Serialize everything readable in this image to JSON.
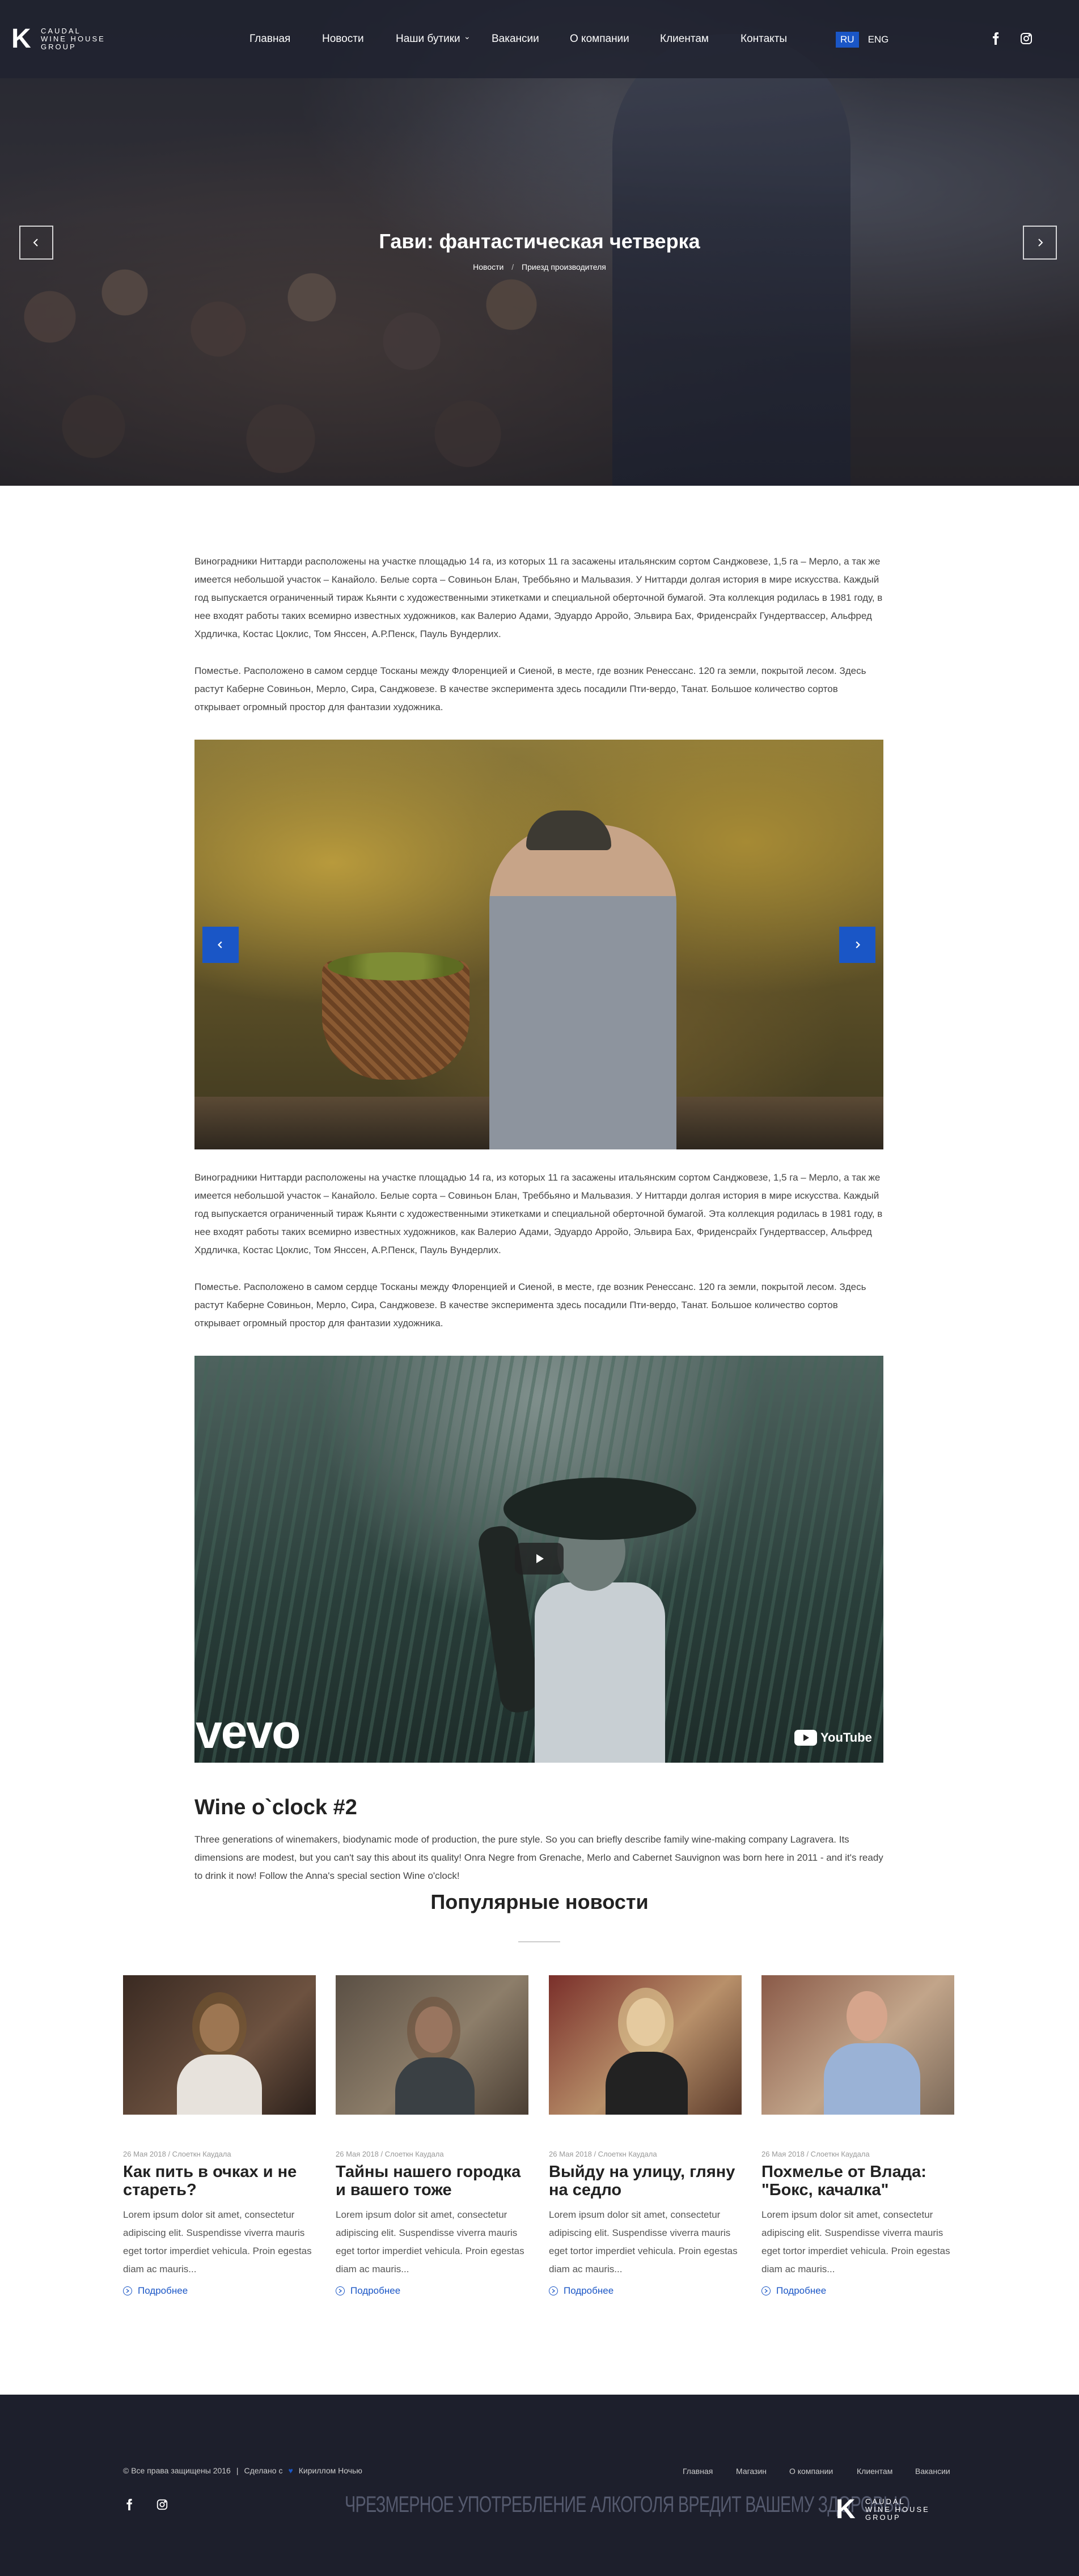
{
  "header": {
    "logo_letter": "K",
    "logo_lines": [
      "CAUDAL",
      "WINE HOUSE",
      "GROUP"
    ],
    "nav": [
      "Главная",
      "Новости",
      "Наши бутики",
      "Вакансии",
      "О компании",
      "Клиентам",
      "Контакты"
    ],
    "lang_active": "RU",
    "lang_other": "ENG",
    "social_icons": [
      "facebook-icon",
      "instagram-icon"
    ]
  },
  "hero": {
    "title": "Гави: фантастическая четверка",
    "breadcrumb": [
      "Новости",
      "Приезд производителя"
    ]
  },
  "article": {
    "paragraphs_top": [
      "Виноградники Ниттарди расположены на участке площадью 14 га, из которых 11 га засажены итальянским сортом Санджовезе, 1,5 га – Мерло, а так же имеется небольшой участок – Канайоло. Белые сорта – Совиньон Блан, Треббьяно и Мальвазия. У Ниттарди долгая история в мире искусства. Каждый год выпускается ограниченный тираж Кьянти с художественными этикетками и специальной оберточной бумагой. Эта коллекция родилась в 1981 году, в нее входят работы таких всемирно известных художников, как Валерио Адами, Эдуардо Арройо, Эльвира Бах, Фриденсрайх Гундертвассер, Альфред Хрдличка, Костас Цоклис, Том Янссен, А.Р.Пенск, Пауль Вундерлих.",
      "Поместье. Расположено в самом сердце Тосканы между Флоренцией и Сиеной, в месте, где возник Ренессанс. 120 га земли, покрытой лесом. Здесь растут Каберне Совиньон, Мерло, Сира, Санджовезе. В качестве эксперимента здесь посадили Пти-вердо, Танат. Большое количество сортов открывает огромный простор для фантазии художника."
    ],
    "paragraphs_bottom": [
      "Виноградники Ниттарди расположены на участке площадью 14 га, из которых 11 га засажены итальянским сортом Санджовезе, 1,5 га – Мерло, а так же имеется небольшой участок – Канайоло. Белые сорта – Совиньон Блан, Треббьяно и Мальвазия. У Ниттарди долгая история в мире искусства. Каждый год выпускается ограниченный тираж Кьянти с художественными этикетками и специальной оберточной бумагой. Эта коллекция родилась в 1981 году, в нее входят работы таких всемирно известных художников, как Валерио Адами, Эдуардо Арройо, Эльвира Бах, Фриденсрайх Гундертвассер, Альфред Хрдличка, Костас Цоклис, Том Янссен, А.Р.Пенск, Пауль Вундерлих.",
      "Поместье. Расположено в самом сердце Тосканы между Флоренцией и Сиеной, в месте, где возник Ренессанс. 120 га земли, покрытой лесом. Здесь растут Каберне Совиньон, Мерло, Сира, Санджовезе. В качестве эксперимента здесь посадили Пти-вердо, Танат. Большое количество сортов открывает огромный простор для фантазии художника."
    ],
    "video": {
      "brand": "vevo",
      "platform": "YouTube"
    },
    "wine_title": "Wine o`clock #2",
    "wine_text": "Three generations of winemakers, biodynamic mode of production, the pure style. So you can briefly describe family wine-making company Lagravera. Its dimensions are modest, but you can't say this about its quality! Onra Negre from Grenache, Merlo and Cabernet Sauvignon was born here in 2011 - and it's ready to drink it now! Follow the Anna's special section Wine o'clock!"
  },
  "popular": {
    "title": "Популярные новости",
    "cards": [
      {
        "meta": "26 Мая 2018 / Слоеткн Каудала",
        "title": "Как пить в очках и не стареть?",
        "text": "Lorem ipsum dolor sit amet, consectetur adipiscing elit. Suspendisse viverra mauris eget tortor imperdiet vehicula. Proin egestas diam ac mauris...",
        "more": "Подробнее"
      },
      {
        "meta": "26 Мая 2018 / Слоеткн Каудала",
        "title": "Тайны нашего городка и вашего тоже",
        "text": "Lorem ipsum dolor sit amet, consectetur adipiscing elit. Suspendisse viverra mauris eget tortor imperdiet vehicula. Proin egestas diam ac mauris...",
        "more": "Подробнее"
      },
      {
        "meta": "26 Мая 2018 / Слоеткн Каудала",
        "title": "Выйду на улицу, гляну на седло",
        "text": "Lorem ipsum dolor sit amet, consectetur adipiscing elit. Suspendisse viverra mauris eget tortor imperdiet vehicula. Proin egestas diam ac mauris...",
        "more": "Подробнее"
      },
      {
        "meta": "26 Мая 2018 / Слоеткн Каудала",
        "title": "Похмелье от Влада: \"Бокс, качалка\"",
        "text": "Lorem ipsum dolor sit amet, consectetur adipiscing elit. Suspendisse viverra mauris eget tortor imperdiet vehicula. Proin egestas diam ac mauris...",
        "more": "Подробнее"
      }
    ]
  },
  "footer": {
    "copyright": "© Все права защищены 2016",
    "made_by_prefix": "Сделано с",
    "made_by": "Кириллом Ночью",
    "links": [
      "Главная",
      "Магазин",
      "О компании",
      "Клиентам",
      "Вакансии"
    ],
    "warning": "ЧРЕЗМЕРНОЕ УПОТРЕБЛЕНИЕ АЛКОГОЛЯ ВРЕДИТ ВАШЕМУ ЗДОРОВЬЮ",
    "logo_letter": "K",
    "logo_lines": [
      "CAUDAL",
      "WINE HOUSE",
      "GROUP"
    ]
  },
  "colors": {
    "accent": "#1a56c6",
    "header_bg": "#202230",
    "footer_bg": "#1d1f2c"
  }
}
